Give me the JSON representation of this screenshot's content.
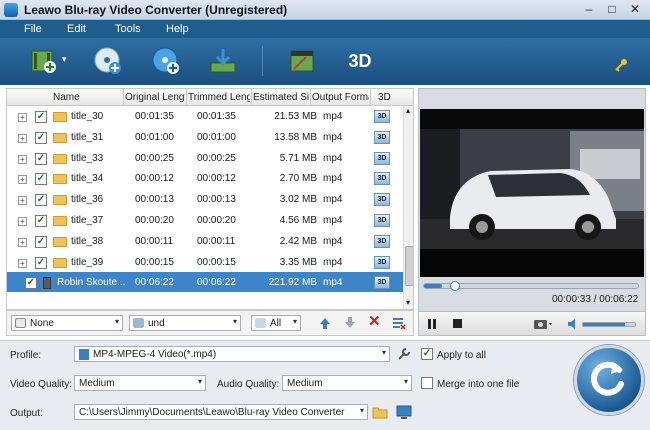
{
  "window": {
    "title": "Leawo Blu-ray Video Converter (Unregistered)",
    "min": "–",
    "max": "□",
    "close": "✕"
  },
  "menu": [
    "File",
    "Edit",
    "Tools",
    "Help"
  ],
  "toolbar": {
    "items": [
      "add-video-icon",
      "add-bluray-icon",
      "add-dvd-icon",
      "download-icon",
      "edit-video-icon",
      "3d-icon"
    ],
    "dropdown_arrow": "▾",
    "threed_label": "3D",
    "register_icon": "key-icon"
  },
  "grid": {
    "columns": [
      "Name",
      "Original Length",
      "Trimmed Length",
      "Estimated Size",
      "Output Format",
      "3D"
    ],
    "rows": [
      {
        "name": "title_30",
        "orig": "00:01:35",
        "trim": "00:01:35",
        "size": "21.53 MB",
        "fmt": "mp4",
        "checked": "✓",
        "expand": "+",
        "selected": false
      },
      {
        "name": "title_31",
        "orig": "00:01:00",
        "trim": "00:01:00",
        "size": "13.58 MB",
        "fmt": "mp4",
        "checked": "✓",
        "expand": "+",
        "selected": false
      },
      {
        "name": "title_33",
        "orig": "00:00:25",
        "trim": "00:00:25",
        "size": "5.71 MB",
        "fmt": "mp4",
        "checked": "✓",
        "expand": "+",
        "selected": false
      },
      {
        "name": "title_34",
        "orig": "00:00:12",
        "trim": "00:00:12",
        "size": "2.70 MB",
        "fmt": "mp4",
        "checked": "✓",
        "expand": "+",
        "selected": false
      },
      {
        "name": "title_36",
        "orig": "00:00:13",
        "trim": "00:00:13",
        "size": "3.02 MB",
        "fmt": "mp4",
        "checked": "✓",
        "expand": "+",
        "selected": false
      },
      {
        "name": "title_37",
        "orig": "00:00:20",
        "trim": "00:00:20",
        "size": "4.56 MB",
        "fmt": "mp4",
        "checked": "✓",
        "expand": "+",
        "selected": false
      },
      {
        "name": "title_38",
        "orig": "00:00:11",
        "trim": "00:00:11",
        "size": "2.42 MB",
        "fmt": "mp4",
        "checked": "✓",
        "expand": "+",
        "selected": false
      },
      {
        "name": "title_39",
        "orig": "00:00:15",
        "trim": "00:00:15",
        "size": "3.35 MB",
        "fmt": "mp4",
        "checked": "✓",
        "expand": "+",
        "selected": false
      },
      {
        "name": "Robin Skoute...",
        "orig": "00:06:22",
        "trim": "00:06:22",
        "size": "221.92 MB",
        "fmt": "mp4",
        "checked": "✓",
        "expand": "",
        "selected": true
      }
    ],
    "threed_badge": "3D",
    "scroll_up": "▴",
    "scroll_down": "▾"
  },
  "gridbar": {
    "subtitle": "None",
    "audio": "und",
    "filter": "All",
    "up_icon": "move-up-icon",
    "down_icon": "move-down-icon",
    "delete_icon": "delete-icon",
    "clear_icon": "clear-list-icon",
    "arrow": "▾",
    "delete_glyph": "✕"
  },
  "preview": {
    "elapsed": "00:00:33",
    "total": "00:06:22",
    "progress": 0.086,
    "volume": 0.8,
    "time_sep": " / "
  },
  "bottom": {
    "profile_label": "Profile:",
    "profile_value": "MP4-MPEG-4 Video(*.mp4)",
    "apply_all": "Apply to all",
    "apply_all_checked": "✓",
    "video_quality_label": "Video Quality:",
    "video_quality": "Medium",
    "audio_quality_label": "Audio Quality:",
    "audio_quality": "Medium",
    "merge_label": "Merge into one file",
    "output_label": "Output:",
    "output_path": "C:\\Users\\Jimmy\\Documents\\Leawo\\Blu-ray Video Converter",
    "arrow": "▾"
  },
  "colors": {
    "menubar": "#1f5d8e",
    "toolbar": "#2e6ea4",
    "selection": "#3d85c8",
    "accent": "#3b7fc3"
  }
}
